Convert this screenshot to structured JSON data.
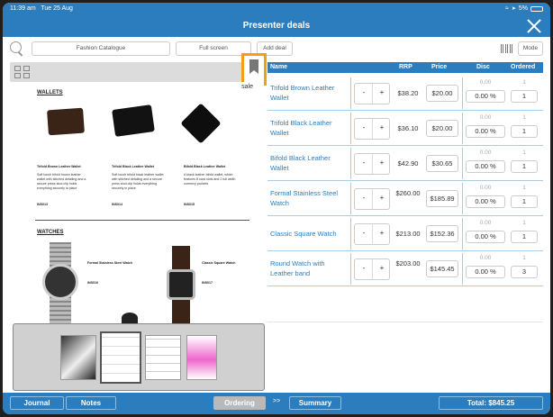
{
  "statusbar": {
    "time": "11:39 am",
    "date": "Tue 25 Aug",
    "battery": "5%",
    "accent": "#2b7dbd"
  },
  "titlebar": {
    "title": "Presenter deals"
  },
  "toolbar": {
    "catalogue": "Fashion Catalogue",
    "fullscreen": "Full screen",
    "add_deal": "Add deal",
    "mode": "Mode"
  },
  "catalog": {
    "corner_text": "sale",
    "wallets_heading": "WALLETS",
    "watches_heading": "WATCHES",
    "wallets": [
      {
        "name": "Trifold Brown Leather Wallet",
        "desc": "Soft touch trifold brown leather wallet with stitched detailing and a secure press stud clip holds everything securely in place",
        "code": "INS013"
      },
      {
        "name": "Trifold Black Leather Wallet",
        "desc": "Soft touch trifold black leather wallet with stitched detailing and a secure press stud clip holds everything securely in place",
        "code": "INS014"
      },
      {
        "name": "Bifold Black Leather Wallet",
        "desc": "A black leather bifold wallet, which features 8 card slots and 2 full width currency pockets",
        "code": "INS015"
      }
    ],
    "watches": [
      {
        "name": "Formal Stainless Steel Watch",
        "code": "INS016"
      },
      {
        "name": "Classic Square Watch",
        "code": "INS017"
      }
    ]
  },
  "table": {
    "headers": {
      "name": "Name",
      "rrp": "RRP",
      "price": "Price",
      "disc": "Disc",
      "ordered": "Ordered"
    },
    "rows": [
      {
        "name": "Trifold Brown Leather Wallet",
        "rrp": "$38.20",
        "price": "$20.00",
        "disc_top": "0.00",
        "disc": "0.00 %",
        "ord_top": "1",
        "ordered": "1"
      },
      {
        "name": "Trifold Black Leather Wallet",
        "rrp": "$36.10",
        "price": "$20.00",
        "disc_top": "0.00",
        "disc": "0.00 %",
        "ord_top": "1",
        "ordered": "1"
      },
      {
        "name": "Bifold Black Leather Wallet",
        "rrp": "$42.90",
        "price": "$30.65",
        "disc_top": "0.00",
        "disc": "0.00 %",
        "ord_top": "1",
        "ordered": "1"
      },
      {
        "name": "Formal Stainless Steel Watch",
        "rrp": "$260.00",
        "price": "$185.89",
        "disc_top": "0.00",
        "disc": "0.00 %",
        "ord_top": "1",
        "ordered": "1"
      },
      {
        "name": "Classic Square Watch",
        "rrp": "$213.00",
        "price": "$152.36",
        "disc_top": "0.00",
        "disc": "0.00 %",
        "ord_top": "1",
        "ordered": "1"
      },
      {
        "name": "Round Watch with Leather band",
        "rrp": "$203.00",
        "price": "$145.45",
        "disc_top": "0.00",
        "disc": "0.00 %",
        "ord_top": "1",
        "ordered": "3"
      }
    ],
    "stepper_minus": "-",
    "stepper_plus": "+"
  },
  "bottombar": {
    "journal": "Journal",
    "notes": "Notes",
    "ordering": "Ordering",
    "arrow": ">>",
    "summary": "Summary",
    "total": "Total: $845.25"
  },
  "icons": {
    "search": "search-icon",
    "close": "close-icon",
    "barcode": "barcode-icon",
    "grid": "grid-icon",
    "bookmark": "bookmark-icon"
  },
  "colors": {
    "accent": "#2b7dbd",
    "highlight": "#f59c1a"
  }
}
